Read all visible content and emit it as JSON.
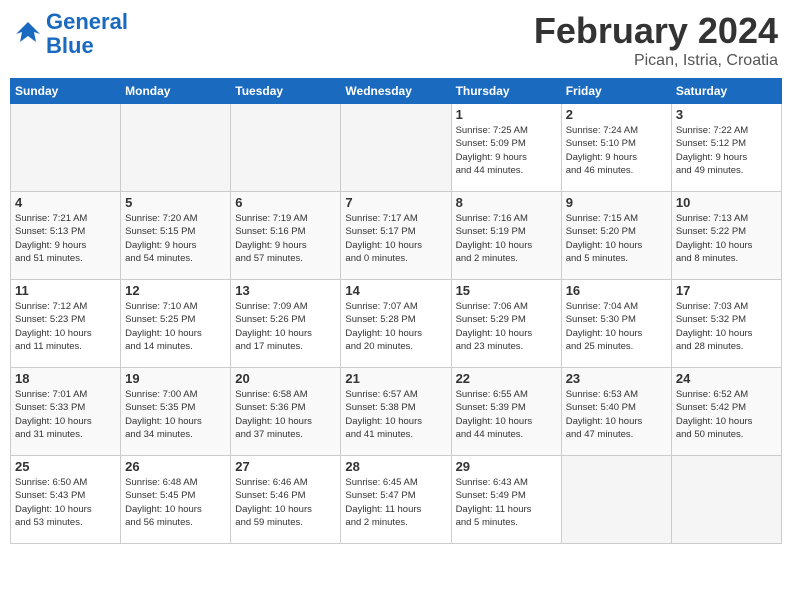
{
  "header": {
    "logo_line1": "General",
    "logo_line2": "Blue",
    "title": "February 2024",
    "location": "Pican, Istria, Croatia"
  },
  "days_of_week": [
    "Sunday",
    "Monday",
    "Tuesday",
    "Wednesday",
    "Thursday",
    "Friday",
    "Saturday"
  ],
  "weeks": [
    [
      {
        "day": "",
        "info": ""
      },
      {
        "day": "",
        "info": ""
      },
      {
        "day": "",
        "info": ""
      },
      {
        "day": "",
        "info": ""
      },
      {
        "day": "1",
        "info": "Sunrise: 7:25 AM\nSunset: 5:09 PM\nDaylight: 9 hours\nand 44 minutes."
      },
      {
        "day": "2",
        "info": "Sunrise: 7:24 AM\nSunset: 5:10 PM\nDaylight: 9 hours\nand 46 minutes."
      },
      {
        "day": "3",
        "info": "Sunrise: 7:22 AM\nSunset: 5:12 PM\nDaylight: 9 hours\nand 49 minutes."
      }
    ],
    [
      {
        "day": "4",
        "info": "Sunrise: 7:21 AM\nSunset: 5:13 PM\nDaylight: 9 hours\nand 51 minutes."
      },
      {
        "day": "5",
        "info": "Sunrise: 7:20 AM\nSunset: 5:15 PM\nDaylight: 9 hours\nand 54 minutes."
      },
      {
        "day": "6",
        "info": "Sunrise: 7:19 AM\nSunset: 5:16 PM\nDaylight: 9 hours\nand 57 minutes."
      },
      {
        "day": "7",
        "info": "Sunrise: 7:17 AM\nSunset: 5:17 PM\nDaylight: 10 hours\nand 0 minutes."
      },
      {
        "day": "8",
        "info": "Sunrise: 7:16 AM\nSunset: 5:19 PM\nDaylight: 10 hours\nand 2 minutes."
      },
      {
        "day": "9",
        "info": "Sunrise: 7:15 AM\nSunset: 5:20 PM\nDaylight: 10 hours\nand 5 minutes."
      },
      {
        "day": "10",
        "info": "Sunrise: 7:13 AM\nSunset: 5:22 PM\nDaylight: 10 hours\nand 8 minutes."
      }
    ],
    [
      {
        "day": "11",
        "info": "Sunrise: 7:12 AM\nSunset: 5:23 PM\nDaylight: 10 hours\nand 11 minutes."
      },
      {
        "day": "12",
        "info": "Sunrise: 7:10 AM\nSunset: 5:25 PM\nDaylight: 10 hours\nand 14 minutes."
      },
      {
        "day": "13",
        "info": "Sunrise: 7:09 AM\nSunset: 5:26 PM\nDaylight: 10 hours\nand 17 minutes."
      },
      {
        "day": "14",
        "info": "Sunrise: 7:07 AM\nSunset: 5:28 PM\nDaylight: 10 hours\nand 20 minutes."
      },
      {
        "day": "15",
        "info": "Sunrise: 7:06 AM\nSunset: 5:29 PM\nDaylight: 10 hours\nand 23 minutes."
      },
      {
        "day": "16",
        "info": "Sunrise: 7:04 AM\nSunset: 5:30 PM\nDaylight: 10 hours\nand 25 minutes."
      },
      {
        "day": "17",
        "info": "Sunrise: 7:03 AM\nSunset: 5:32 PM\nDaylight: 10 hours\nand 28 minutes."
      }
    ],
    [
      {
        "day": "18",
        "info": "Sunrise: 7:01 AM\nSunset: 5:33 PM\nDaylight: 10 hours\nand 31 minutes."
      },
      {
        "day": "19",
        "info": "Sunrise: 7:00 AM\nSunset: 5:35 PM\nDaylight: 10 hours\nand 34 minutes."
      },
      {
        "day": "20",
        "info": "Sunrise: 6:58 AM\nSunset: 5:36 PM\nDaylight: 10 hours\nand 37 minutes."
      },
      {
        "day": "21",
        "info": "Sunrise: 6:57 AM\nSunset: 5:38 PM\nDaylight: 10 hours\nand 41 minutes."
      },
      {
        "day": "22",
        "info": "Sunrise: 6:55 AM\nSunset: 5:39 PM\nDaylight: 10 hours\nand 44 minutes."
      },
      {
        "day": "23",
        "info": "Sunrise: 6:53 AM\nSunset: 5:40 PM\nDaylight: 10 hours\nand 47 minutes."
      },
      {
        "day": "24",
        "info": "Sunrise: 6:52 AM\nSunset: 5:42 PM\nDaylight: 10 hours\nand 50 minutes."
      }
    ],
    [
      {
        "day": "25",
        "info": "Sunrise: 6:50 AM\nSunset: 5:43 PM\nDaylight: 10 hours\nand 53 minutes."
      },
      {
        "day": "26",
        "info": "Sunrise: 6:48 AM\nSunset: 5:45 PM\nDaylight: 10 hours\nand 56 minutes."
      },
      {
        "day": "27",
        "info": "Sunrise: 6:46 AM\nSunset: 5:46 PM\nDaylight: 10 hours\nand 59 minutes."
      },
      {
        "day": "28",
        "info": "Sunrise: 6:45 AM\nSunset: 5:47 PM\nDaylight: 11 hours\nand 2 minutes."
      },
      {
        "day": "29",
        "info": "Sunrise: 6:43 AM\nSunset: 5:49 PM\nDaylight: 11 hours\nand 5 minutes."
      },
      {
        "day": "",
        "info": ""
      },
      {
        "day": "",
        "info": ""
      }
    ]
  ]
}
